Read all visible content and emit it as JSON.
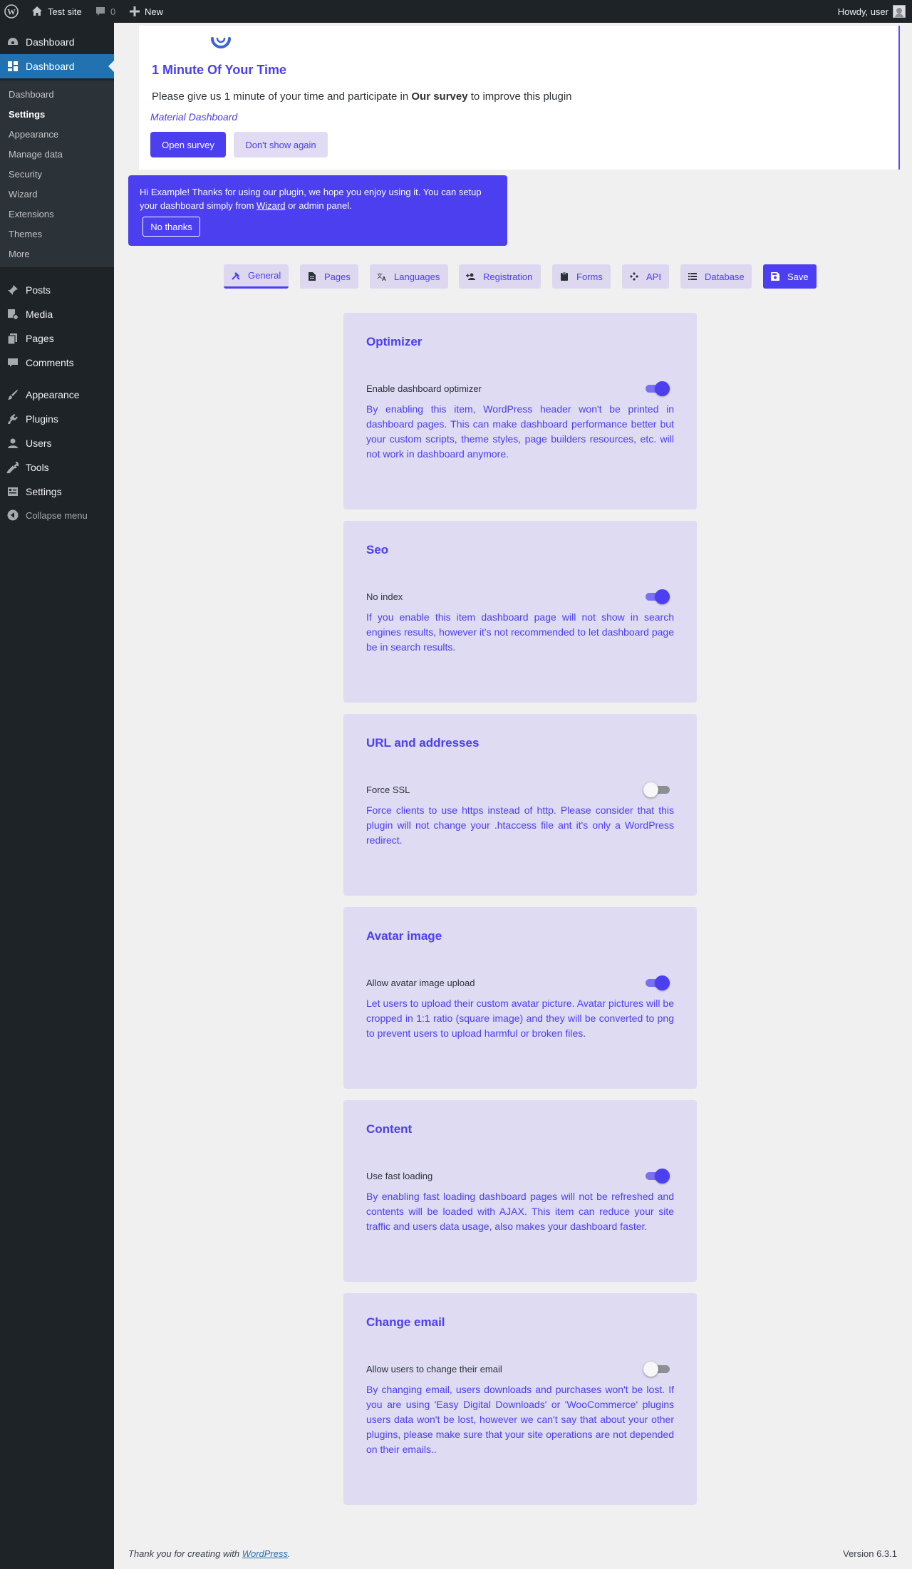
{
  "adminbar": {
    "site_name": "Test site",
    "comments_count": "0",
    "new_label": "New",
    "howdy": "Howdy, user"
  },
  "sidebar": {
    "top_items": [
      {
        "label": "Dashboard",
        "icon": "dashboard-gauge-icon"
      },
      {
        "label": "Dashboard",
        "icon": "grid-icon",
        "current": true
      }
    ],
    "submenu": [
      "Dashboard",
      "Settings",
      "Appearance",
      "Manage data",
      "Security",
      "Wizard",
      "Extensions",
      "Themes",
      "More"
    ],
    "active_submenu": "Settings",
    "items": [
      {
        "label": "Posts",
        "icon": "pin-icon"
      },
      {
        "label": "Media",
        "icon": "media-icon"
      },
      {
        "label": "Pages",
        "icon": "pages-icon"
      },
      {
        "label": "Comments",
        "icon": "comment-icon"
      },
      {
        "label": "Appearance",
        "icon": "brush-icon"
      },
      {
        "label": "Plugins",
        "icon": "plug-icon"
      },
      {
        "label": "Users",
        "icon": "user-icon"
      },
      {
        "label": "Tools",
        "icon": "wrench-icon"
      },
      {
        "label": "Settings",
        "icon": "settings-icon"
      }
    ],
    "collapse_label": "Collapse menu"
  },
  "survey": {
    "title": "1 Minute Of Your Time",
    "message_before": "Please give us 1 minute of your time and participate in ",
    "message_bold": "Our survey",
    "message_after": " to improve this plugin",
    "brand": "Material Dashboard",
    "open_label": "Open survey",
    "dismiss_label": "Don't show again"
  },
  "welcome": {
    "text_before": "Hi Example! Thanks for using our plugin, we hope you enjoy using it. You can setup your dashboard simply from ",
    "link": "Wizard",
    "text_after": " or admin panel.",
    "no_thanks": "No thanks"
  },
  "tabs": [
    {
      "label": "General",
      "icon": "tools-icon",
      "active": true
    },
    {
      "label": "Pages",
      "icon": "document-icon"
    },
    {
      "label": "Languages",
      "icon": "translate-icon"
    },
    {
      "label": "Registration",
      "icon": "person-add-icon"
    },
    {
      "label": "Forms",
      "icon": "clipboard-icon"
    },
    {
      "label": "API",
      "icon": "api-icon"
    },
    {
      "label": "Database",
      "icon": "list-icon"
    },
    {
      "label": "Save",
      "icon": "save-icon",
      "primary": true
    }
  ],
  "cards": [
    {
      "title": "Optimizer",
      "option": "Enable dashboard optimizer",
      "enabled": true,
      "description": "By enabling this item, WordPress header won't be printed in dashboard pages. This can make dashboard performance better but your custom scripts, theme styles, page builders resources, etc. will not work in dashboard anymore."
    },
    {
      "title": "Seo",
      "option": "No index",
      "enabled": true,
      "description": "If you enable this item dashboard page will not show in search engines results, however it's not recommended to let dashboard page be in search results."
    },
    {
      "title": "URL and addresses",
      "option": "Force SSL",
      "enabled": false,
      "description": "Force clients to use https instead of http. Please consider that this plugin will not change your .htaccess file ant it's only a WordPress redirect."
    },
    {
      "title": "Avatar image",
      "option": "Allow avatar image upload",
      "enabled": true,
      "description": "Let users to upload their custom avatar picture. Avatar pictures will be cropped in 1:1 ratio (square image) and they will be converted to png to prevent users to upload harmful or broken files."
    },
    {
      "title": "Content",
      "option": "Use fast loading",
      "enabled": true,
      "description": "By enabling fast loading dashboard pages will not be refreshed and contents will be loaded with AJAX. This item can reduce your site traffic and users data usage, also makes your dashboard faster."
    },
    {
      "title": "Change email",
      "option": "Allow users to change their email",
      "enabled": false,
      "description": "By changing email, users downloads and purchases won't be lost. If you are using 'Easy Digital Downloads' or 'WooCommerce' plugins users data won't be lost, however we can't say that about your other plugins, please make sure that your site operations are not depended on their emails.."
    }
  ],
  "footer": {
    "thanks_before": "Thank you for creating with ",
    "thanks_link": "WordPress",
    "thanks_after": ".",
    "version": "Version 6.3.1"
  },
  "colors": {
    "accent": "#4b3ff0",
    "card_bg": "#dedbf3",
    "admin_dark": "#1d2327",
    "wp_blue": "#2271b1"
  }
}
